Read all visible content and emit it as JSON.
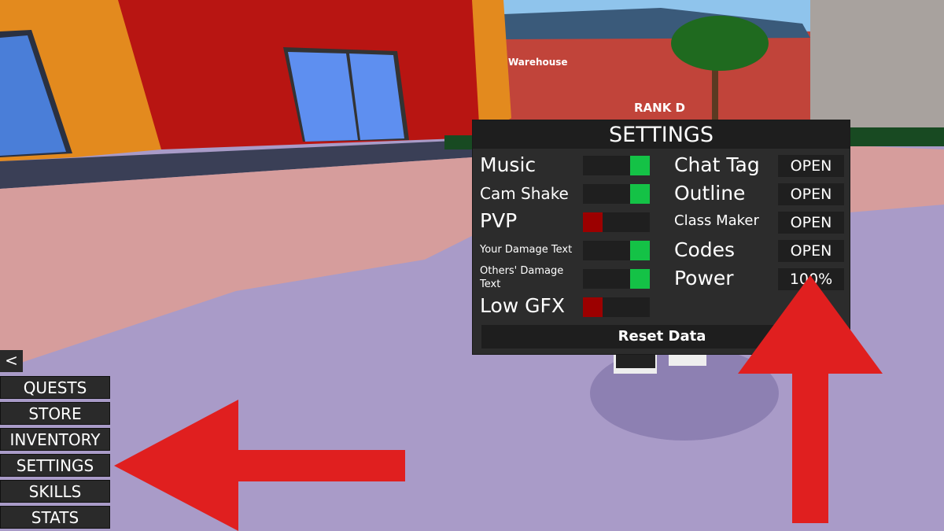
{
  "world": {
    "building_sign": "Warehouse",
    "rank_label": "RANK D"
  },
  "settings": {
    "title": "SETTINGS",
    "toggles": [
      {
        "label": "Music",
        "state": "on"
      },
      {
        "label": "Cam Shake",
        "state": "on"
      },
      {
        "label": "PVP",
        "state": "off"
      },
      {
        "label": "Your Damage Text",
        "state": "on"
      },
      {
        "label": "Others' Damage Text",
        "state": "on"
      },
      {
        "label": "Low GFX",
        "state": "off"
      }
    ],
    "options": [
      {
        "label": "Chat Tag",
        "value": "OPEN"
      },
      {
        "label": "Outline",
        "value": "OPEN"
      },
      {
        "label": "Class Maker",
        "value": "OPEN"
      },
      {
        "label": "Codes",
        "value": "OPEN"
      },
      {
        "label": "Power",
        "value": "100%"
      }
    ],
    "reset_label": "Reset Data",
    "colors": {
      "on": "#14c246",
      "off": "#9c0000"
    }
  },
  "menu": {
    "collapse_label": "<",
    "items": [
      "QUESTS",
      "STORE",
      "INVENTORY",
      "SETTINGS",
      "SKILLS",
      "STATS"
    ]
  },
  "annotations": {
    "arrow_color": "#e01f1f",
    "arrows": [
      "left-arrow-to-settings-menu",
      "up-arrow-to-codes"
    ]
  }
}
